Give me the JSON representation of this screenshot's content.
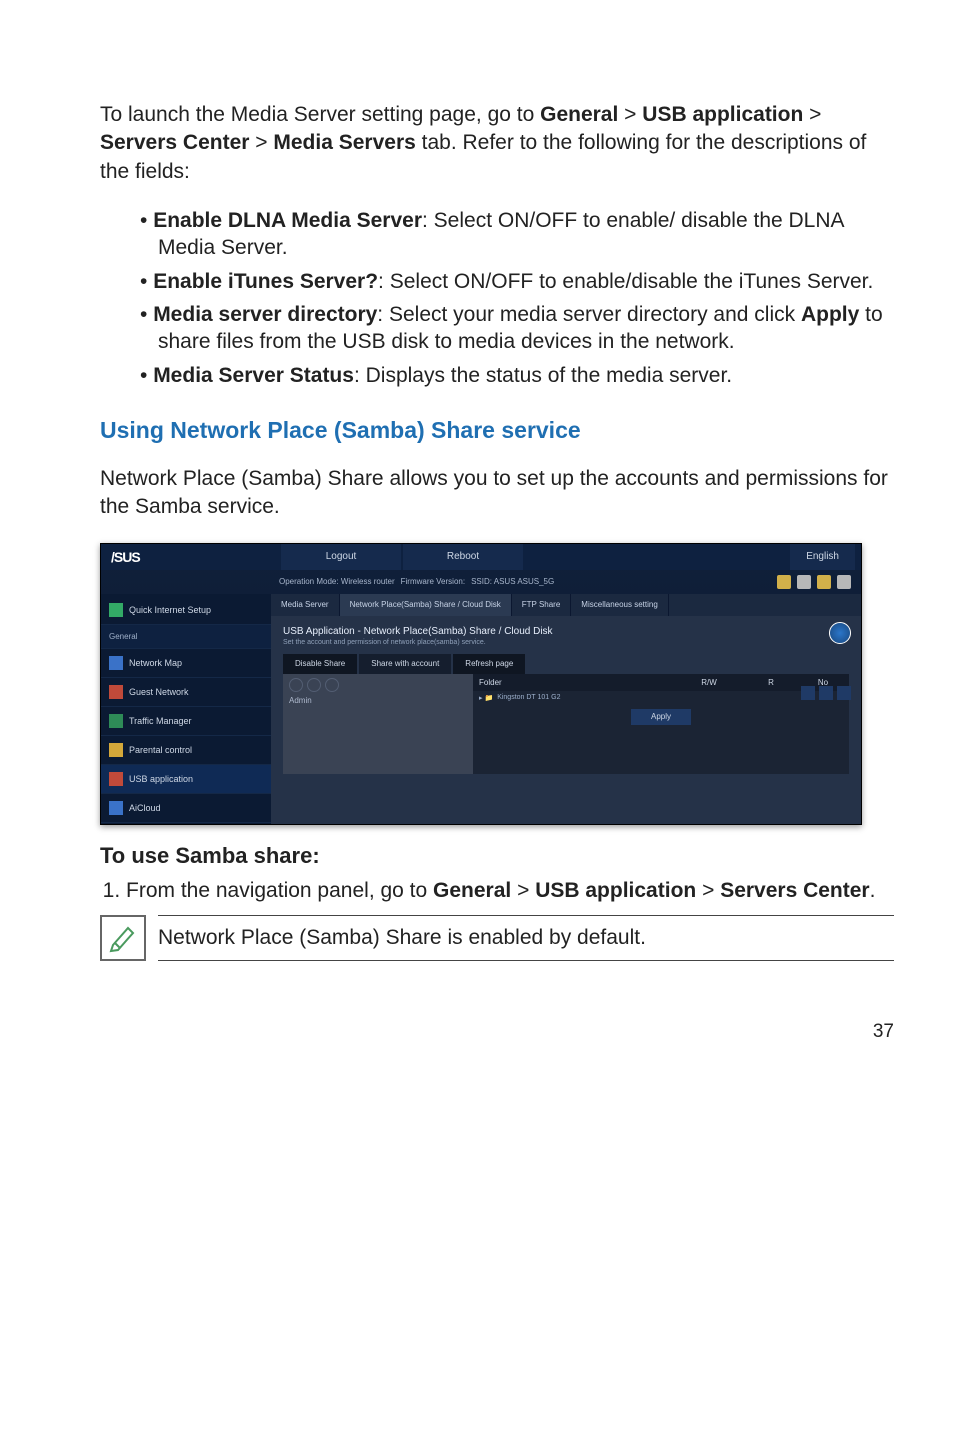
{
  "intro": {
    "prefix": "To launch the Media Server setting page, go to ",
    "path1": "General",
    "sep": " > ",
    "path2": "USB application",
    "path3": "Servers Center",
    "path4": "Media Servers",
    "suffix": " tab. Refer to the following for the descriptions of the fields:"
  },
  "bullets": [
    {
      "b": "Enable DLNA Media Server",
      "t": ": Select ON/OFF to enable/ disable the DLNA Media Server."
    },
    {
      "b": "Enable iTunes Server?",
      "t": ": Select ON/OFF to enable/disable the iTunes Server."
    },
    {
      "b": "Media server directory",
      "t1": ": Select your media server directory and click ",
      "b2": "Apply",
      "t2": " to share files from the USB disk to media devices in the network."
    },
    {
      "b": "Media Server Status",
      "t": ": Displays the status of the media server."
    }
  ],
  "section_heading": "Using Network Place (Samba) Share service",
  "section_body": "Network Place (Samba) Share allows you to set up the accounts and permissions for the Samba service.",
  "screenshot": {
    "logo": "/SUS",
    "top_logout": "Logout",
    "top_reboot": "Reboot",
    "lang": "English",
    "op_mode": "Operation Mode: Wireless router",
    "fw": "Firmware Version:",
    "ssid": "SSID: ASUS  ASUS_5G",
    "sidebar_qis": "Quick Internet Setup",
    "sidebar_header": "General",
    "sidebar_items": [
      "Network Map",
      "Guest Network",
      "Traffic Manager",
      "Parental control",
      "USB application",
      "AiCloud"
    ],
    "tabs": [
      "Media Server",
      "Network Place(Samba) Share / Cloud Disk",
      "FTP Share",
      "Miscellaneous setting"
    ],
    "panel_title": "USB Application - Network Place(Samba) Share / Cloud Disk",
    "panel_sub": "Set the account and permission of network place(samba) service.",
    "seg_disable": "Disable Share",
    "seg_share": "Share with account",
    "seg_refresh": "Refresh page",
    "tree_item": "Admin",
    "fl_headers": [
      "Folder",
      "R/W",
      "R",
      "No"
    ],
    "fl_row": "Kingston DT 101 G2",
    "apply": "Apply"
  },
  "subhead": "To use Samba share:",
  "step1": {
    "pre": "From the navigation panel, go to ",
    "p1": "General",
    "p2": "USB application",
    "p3": "Servers Center",
    "dot": "."
  },
  "note_text": "Network Place (Samba) Share is enabled by default.",
  "page_number": "37"
}
